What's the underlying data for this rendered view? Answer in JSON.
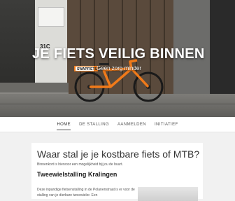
{
  "hero": {
    "title": "JE FIETS VEILIG BINNEN",
    "subtitle": "Geen zorg minder",
    "house_number": "31C",
    "bike_brand": "SWAPFIETS",
    "bike_color": "#f07a1a"
  },
  "nav": {
    "items": [
      {
        "label": "HOME",
        "active": true
      },
      {
        "label": "DE STALLING",
        "active": false
      },
      {
        "label": "AANMELDEN",
        "active": false
      },
      {
        "label": "INITIATIEF",
        "active": false
      }
    ]
  },
  "main": {
    "heading": "Waar stal je je kostbare fiets of MTB?",
    "intro": "Binnenkort is hiervoor een mogelijkheid bij jou de buurt.",
    "section_title": "Tweewielstalling Kralingen",
    "paragraph": "Deze inpandige fietsenstalling in de Polanenstraat is er voor de stalling van je dierbare tweewieler. Een"
  }
}
